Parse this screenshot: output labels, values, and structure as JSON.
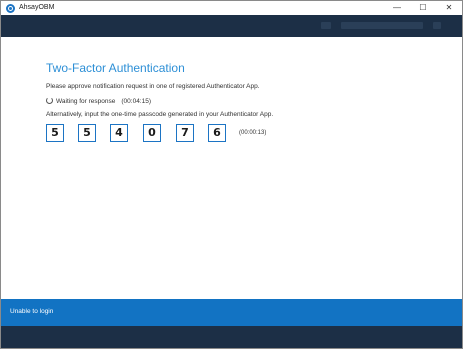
{
  "window": {
    "title": "AhsayOBM",
    "controls": {
      "minimize": "—",
      "maximize": "☐",
      "close": "✕"
    }
  },
  "twofa": {
    "heading": "Two-Factor Authentication",
    "notification_text": "Please approve notification request in one of registered Authenticator App.",
    "waiting_text": "Waiting for response",
    "waiting_timer": "(00:04:15)",
    "passcode_instruction": "Alternatively, input the one-time passcode generated in your Authenticator App.",
    "digits": [
      "5",
      "5",
      "4",
      "0",
      "7",
      "6"
    ],
    "passcode_timer": "(00:00:13)"
  },
  "footer": {
    "link_label": "Unable to login"
  },
  "colors": {
    "accent": "#2d8fd6",
    "footer_blue": "#1273c3",
    "dark_band": "#1c2f46",
    "digit_border": "#1c74c4"
  }
}
